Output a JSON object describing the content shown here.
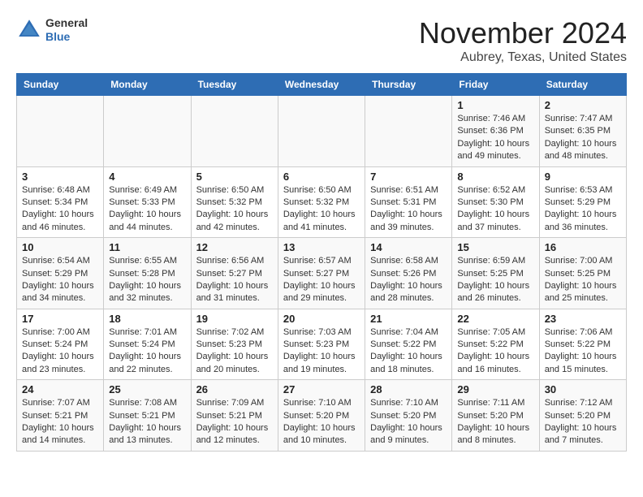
{
  "header": {
    "logo_general": "General",
    "logo_blue": "Blue",
    "month_title": "November 2024",
    "location": "Aubrey, Texas, United States"
  },
  "calendar": {
    "weekdays": [
      "Sunday",
      "Monday",
      "Tuesday",
      "Wednesday",
      "Thursday",
      "Friday",
      "Saturday"
    ],
    "weeks": [
      [
        {
          "day": "",
          "info": ""
        },
        {
          "day": "",
          "info": ""
        },
        {
          "day": "",
          "info": ""
        },
        {
          "day": "",
          "info": ""
        },
        {
          "day": "",
          "info": ""
        },
        {
          "day": "1",
          "info": "Sunrise: 7:46 AM\nSunset: 6:36 PM\nDaylight: 10 hours and 49 minutes."
        },
        {
          "day": "2",
          "info": "Sunrise: 7:47 AM\nSunset: 6:35 PM\nDaylight: 10 hours and 48 minutes."
        }
      ],
      [
        {
          "day": "3",
          "info": "Sunrise: 6:48 AM\nSunset: 5:34 PM\nDaylight: 10 hours and 46 minutes."
        },
        {
          "day": "4",
          "info": "Sunrise: 6:49 AM\nSunset: 5:33 PM\nDaylight: 10 hours and 44 minutes."
        },
        {
          "day": "5",
          "info": "Sunrise: 6:50 AM\nSunset: 5:32 PM\nDaylight: 10 hours and 42 minutes."
        },
        {
          "day": "6",
          "info": "Sunrise: 6:50 AM\nSunset: 5:32 PM\nDaylight: 10 hours and 41 minutes."
        },
        {
          "day": "7",
          "info": "Sunrise: 6:51 AM\nSunset: 5:31 PM\nDaylight: 10 hours and 39 minutes."
        },
        {
          "day": "8",
          "info": "Sunrise: 6:52 AM\nSunset: 5:30 PM\nDaylight: 10 hours and 37 minutes."
        },
        {
          "day": "9",
          "info": "Sunrise: 6:53 AM\nSunset: 5:29 PM\nDaylight: 10 hours and 36 minutes."
        }
      ],
      [
        {
          "day": "10",
          "info": "Sunrise: 6:54 AM\nSunset: 5:29 PM\nDaylight: 10 hours and 34 minutes."
        },
        {
          "day": "11",
          "info": "Sunrise: 6:55 AM\nSunset: 5:28 PM\nDaylight: 10 hours and 32 minutes."
        },
        {
          "day": "12",
          "info": "Sunrise: 6:56 AM\nSunset: 5:27 PM\nDaylight: 10 hours and 31 minutes."
        },
        {
          "day": "13",
          "info": "Sunrise: 6:57 AM\nSunset: 5:27 PM\nDaylight: 10 hours and 29 minutes."
        },
        {
          "day": "14",
          "info": "Sunrise: 6:58 AM\nSunset: 5:26 PM\nDaylight: 10 hours and 28 minutes."
        },
        {
          "day": "15",
          "info": "Sunrise: 6:59 AM\nSunset: 5:25 PM\nDaylight: 10 hours and 26 minutes."
        },
        {
          "day": "16",
          "info": "Sunrise: 7:00 AM\nSunset: 5:25 PM\nDaylight: 10 hours and 25 minutes."
        }
      ],
      [
        {
          "day": "17",
          "info": "Sunrise: 7:00 AM\nSunset: 5:24 PM\nDaylight: 10 hours and 23 minutes."
        },
        {
          "day": "18",
          "info": "Sunrise: 7:01 AM\nSunset: 5:24 PM\nDaylight: 10 hours and 22 minutes."
        },
        {
          "day": "19",
          "info": "Sunrise: 7:02 AM\nSunset: 5:23 PM\nDaylight: 10 hours and 20 minutes."
        },
        {
          "day": "20",
          "info": "Sunrise: 7:03 AM\nSunset: 5:23 PM\nDaylight: 10 hours and 19 minutes."
        },
        {
          "day": "21",
          "info": "Sunrise: 7:04 AM\nSunset: 5:22 PM\nDaylight: 10 hours and 18 minutes."
        },
        {
          "day": "22",
          "info": "Sunrise: 7:05 AM\nSunset: 5:22 PM\nDaylight: 10 hours and 16 minutes."
        },
        {
          "day": "23",
          "info": "Sunrise: 7:06 AM\nSunset: 5:22 PM\nDaylight: 10 hours and 15 minutes."
        }
      ],
      [
        {
          "day": "24",
          "info": "Sunrise: 7:07 AM\nSunset: 5:21 PM\nDaylight: 10 hours and 14 minutes."
        },
        {
          "day": "25",
          "info": "Sunrise: 7:08 AM\nSunset: 5:21 PM\nDaylight: 10 hours and 13 minutes."
        },
        {
          "day": "26",
          "info": "Sunrise: 7:09 AM\nSunset: 5:21 PM\nDaylight: 10 hours and 12 minutes."
        },
        {
          "day": "27",
          "info": "Sunrise: 7:10 AM\nSunset: 5:20 PM\nDaylight: 10 hours and 10 minutes."
        },
        {
          "day": "28",
          "info": "Sunrise: 7:10 AM\nSunset: 5:20 PM\nDaylight: 10 hours and 9 minutes."
        },
        {
          "day": "29",
          "info": "Sunrise: 7:11 AM\nSunset: 5:20 PM\nDaylight: 10 hours and 8 minutes."
        },
        {
          "day": "30",
          "info": "Sunrise: 7:12 AM\nSunset: 5:20 PM\nDaylight: 10 hours and 7 minutes."
        }
      ]
    ]
  }
}
